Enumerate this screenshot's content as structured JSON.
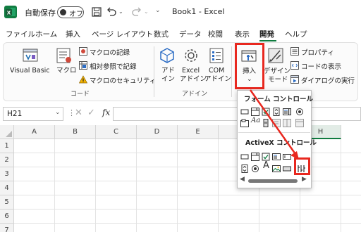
{
  "titlebar": {
    "autosave_label": "自動保存",
    "autosave_state": "オフ",
    "document_title": "Book1  -  Excel"
  },
  "menu": {
    "tabs": [
      "ファイル",
      "ホーム",
      "挿入",
      "ページ レイアウト",
      "数式",
      "データ",
      "校閲",
      "表示",
      "開発",
      "ヘルプ"
    ],
    "active_tab": "開発"
  },
  "ribbon": {
    "code_group": {
      "visual_basic": "Visual Basic",
      "macro": "マクロ",
      "record_macro": "マクロの記録",
      "relative_ref": "相対参照で記録",
      "macro_security": "マクロのセキュリティ",
      "group_label": "コード"
    },
    "addin_group": {
      "addin_l1": "アド",
      "addin_l2": "イン",
      "excel_addin_l1": "Excel",
      "excel_addin_l2": "アドイン",
      "com_addin_l1": "COM",
      "com_addin_l2": "アドイン",
      "group_label": "アドイン"
    },
    "controls_group": {
      "insert": "挿入",
      "design_mode_l1": "デザイン",
      "design_mode_l2": "モード",
      "properties": "プロパティ",
      "view_code": "コードの表示",
      "run_dialog": "ダイアログの実行"
    }
  },
  "formula_bar": {
    "name_box": "H21",
    "fx": "fx"
  },
  "grid": {
    "columns": [
      "A",
      "B",
      "C",
      "D",
      "E",
      "F",
      "G",
      "H"
    ],
    "rows": [
      "1",
      "2",
      "3",
      "4",
      "5",
      "6",
      "7"
    ]
  },
  "insert_dropdown": {
    "form_controls_title": "フォーム コントロール",
    "activex_controls_title": "ActiveX コントロール",
    "label_glyph": "Aa",
    "activex_label_glyph": "A"
  },
  "colors": {
    "accent_green": "#0f7b3f",
    "highlight_red": "#e8281f"
  }
}
